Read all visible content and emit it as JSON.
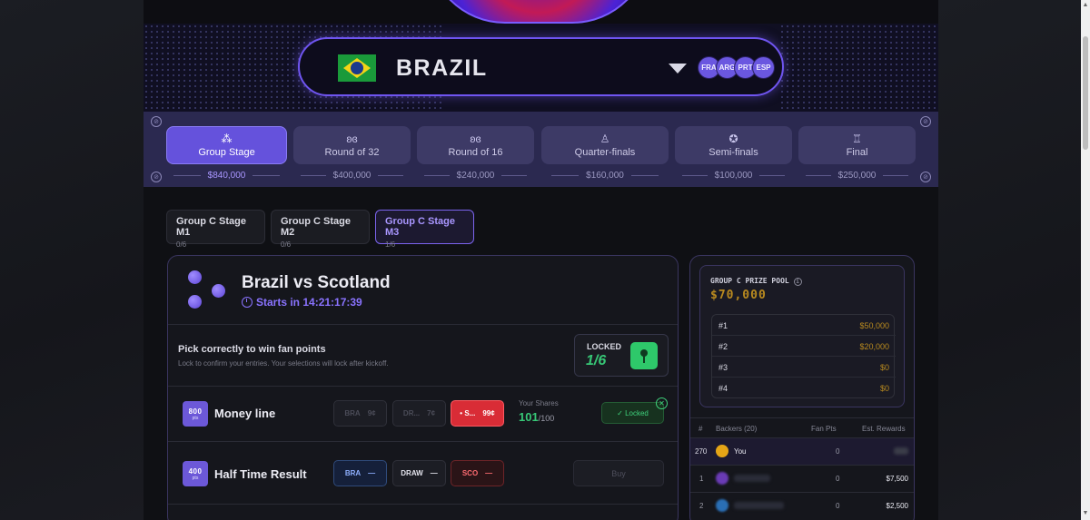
{
  "team": {
    "name": "BRAZIL",
    "flag": "brazil-flag",
    "others": [
      "FRA",
      "ARG",
      "PRT",
      "ESP"
    ]
  },
  "stages": [
    {
      "label": "Group Stage",
      "prize": "$840,000",
      "icon": "group-icon",
      "active": true
    },
    {
      "label": "Round of 32",
      "prize": "$400,000",
      "icon": "laurel-icon"
    },
    {
      "label": "Round of 16",
      "prize": "$240,000",
      "icon": "laurel-icon"
    },
    {
      "label": "Quarter-finals",
      "prize": "$160,000",
      "icon": "trophy-icon"
    },
    {
      "label": "Semi-finals",
      "prize": "$100,000",
      "icon": "medal-icon"
    },
    {
      "label": "Final",
      "prize": "$250,000",
      "icon": "trophy-icon"
    }
  ],
  "match_tabs": [
    {
      "title": "Group C Stage M1",
      "progress": "0/6"
    },
    {
      "title": "Group C Stage M2",
      "progress": "0/6"
    },
    {
      "title": "Group C Stage M3",
      "progress": "1/6",
      "active": true
    }
  ],
  "match": {
    "title": "Brazil vs Scotland",
    "starts": "Starts in 14:21:17:39",
    "pick_title": "Pick correctly to win fan points",
    "pick_sub": "Lock to confirm your entries. Your selections will lock after kickoff.",
    "locked_label": "LOCKED",
    "locked_value": "1/6"
  },
  "markets": [
    {
      "pts": "800",
      "pts_unit": "pts",
      "title": "Money line",
      "options": [
        {
          "label": "BRA",
          "price": "9¢"
        },
        {
          "label": "DR...",
          "price": "7¢"
        },
        {
          "label": "• S...",
          "price": "99¢"
        }
      ],
      "shares_label": "Your Shares",
      "shares_value": "101",
      "shares_total": "/100",
      "status": "Locked",
      "close": "✕"
    },
    {
      "pts": "400",
      "pts_unit": "pts",
      "title": "Half Time Result",
      "options": [
        {
          "label": "BRA",
          "price": "—"
        },
        {
          "label": "DRAW",
          "price": "—"
        },
        {
          "label": "SCO",
          "price": "—"
        }
      ],
      "buy": "Buy"
    }
  ],
  "pool": {
    "label": "GROUP C PRIZE POOL",
    "info": "i",
    "value": "$70,000",
    "ranks": [
      {
        "place": "#1",
        "amount": "$50,000"
      },
      {
        "place": "#2",
        "amount": "$20,000"
      },
      {
        "place": "#3",
        "amount": "$0"
      },
      {
        "place": "#4",
        "amount": "$0"
      }
    ]
  },
  "backers": {
    "headers": {
      "num": "#",
      "backers": "Backers (20)",
      "pts": "Fan Pts",
      "rewards": "Est. Rewards"
    },
    "rows": [
      {
        "num": "270",
        "name": "You",
        "pts": "0",
        "reward": ""
      },
      {
        "num": "1",
        "name": "",
        "pts": "0",
        "reward": "$7,500"
      },
      {
        "num": "2",
        "name": "",
        "pts": "0",
        "reward": "$2,500"
      }
    ]
  },
  "colors": {
    "accent": "#6552dc",
    "green": "#37c776",
    "gold": "#b98a1f",
    "red": "#d92c36"
  }
}
